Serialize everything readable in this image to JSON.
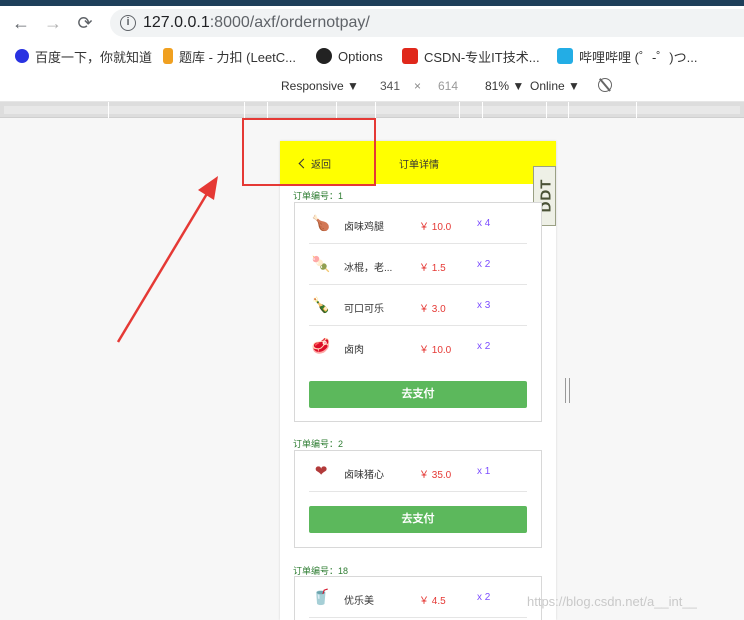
{
  "browser": {
    "url_host": "127.0.0.1",
    "url_path": ":8000/axf/ordernotpay/"
  },
  "bookmarks": [
    {
      "label": "百度一下，你就知道",
      "icon": "baidu-icon",
      "color": "#2932e1"
    },
    {
      "label": "题库 - 力扣 (LeetC...",
      "icon": "leetcode-icon",
      "color": "#f0a020"
    },
    {
      "label": "Options",
      "icon": "github-icon",
      "color": "#222222"
    },
    {
      "label": "CSDN-专业IT技术...",
      "icon": "csdn-icon",
      "color": "#e0281b"
    },
    {
      "label": "哔哩哔哩 (゜-゜)つ...",
      "icon": "bilibili-icon",
      "color": "#23ade5"
    }
  ],
  "devtools": {
    "device": "Responsive ▼",
    "width": "341",
    "times": "×",
    "height": "614",
    "zoom": "81% ▼",
    "network": "Online ▼"
  },
  "app": {
    "back_label": "返回",
    "header_title": "订单详情",
    "badge_text": "DDT",
    "header_color": "#ffff00",
    "pay_button_color": "#5cb85c",
    "orders": [
      {
        "label": "订单编号：1",
        "items": [
          {
            "name": "卤味鸡腿",
            "price": "￥ 10.0",
            "qty": "x 4",
            "icon": "🍗"
          },
          {
            "name": "冰棍，老...",
            "price": "￥ 1.5",
            "qty": "x 2",
            "icon": "🍡"
          },
          {
            "name": "可口可乐",
            "price": "￥ 3.0",
            "qty": "x 3",
            "icon": "🍾"
          },
          {
            "name": "卤肉",
            "price": "￥ 10.0",
            "qty": "x 2",
            "icon": "🥩"
          }
        ],
        "pay_label": "去支付"
      },
      {
        "label": "订单编号：2",
        "items": [
          {
            "name": "卤味猪心",
            "price": "￥ 35.0",
            "qty": "x 1",
            "icon": "❤"
          }
        ],
        "pay_label": "去支付"
      },
      {
        "label": "订单编号：18",
        "items": [
          {
            "name": "优乐美",
            "price": "￥ 4.5",
            "qty": "x 2",
            "icon": "🥤"
          }
        ],
        "pay_label": ""
      }
    ]
  },
  "watermark": "https://blog.csdn.net/a__int__"
}
